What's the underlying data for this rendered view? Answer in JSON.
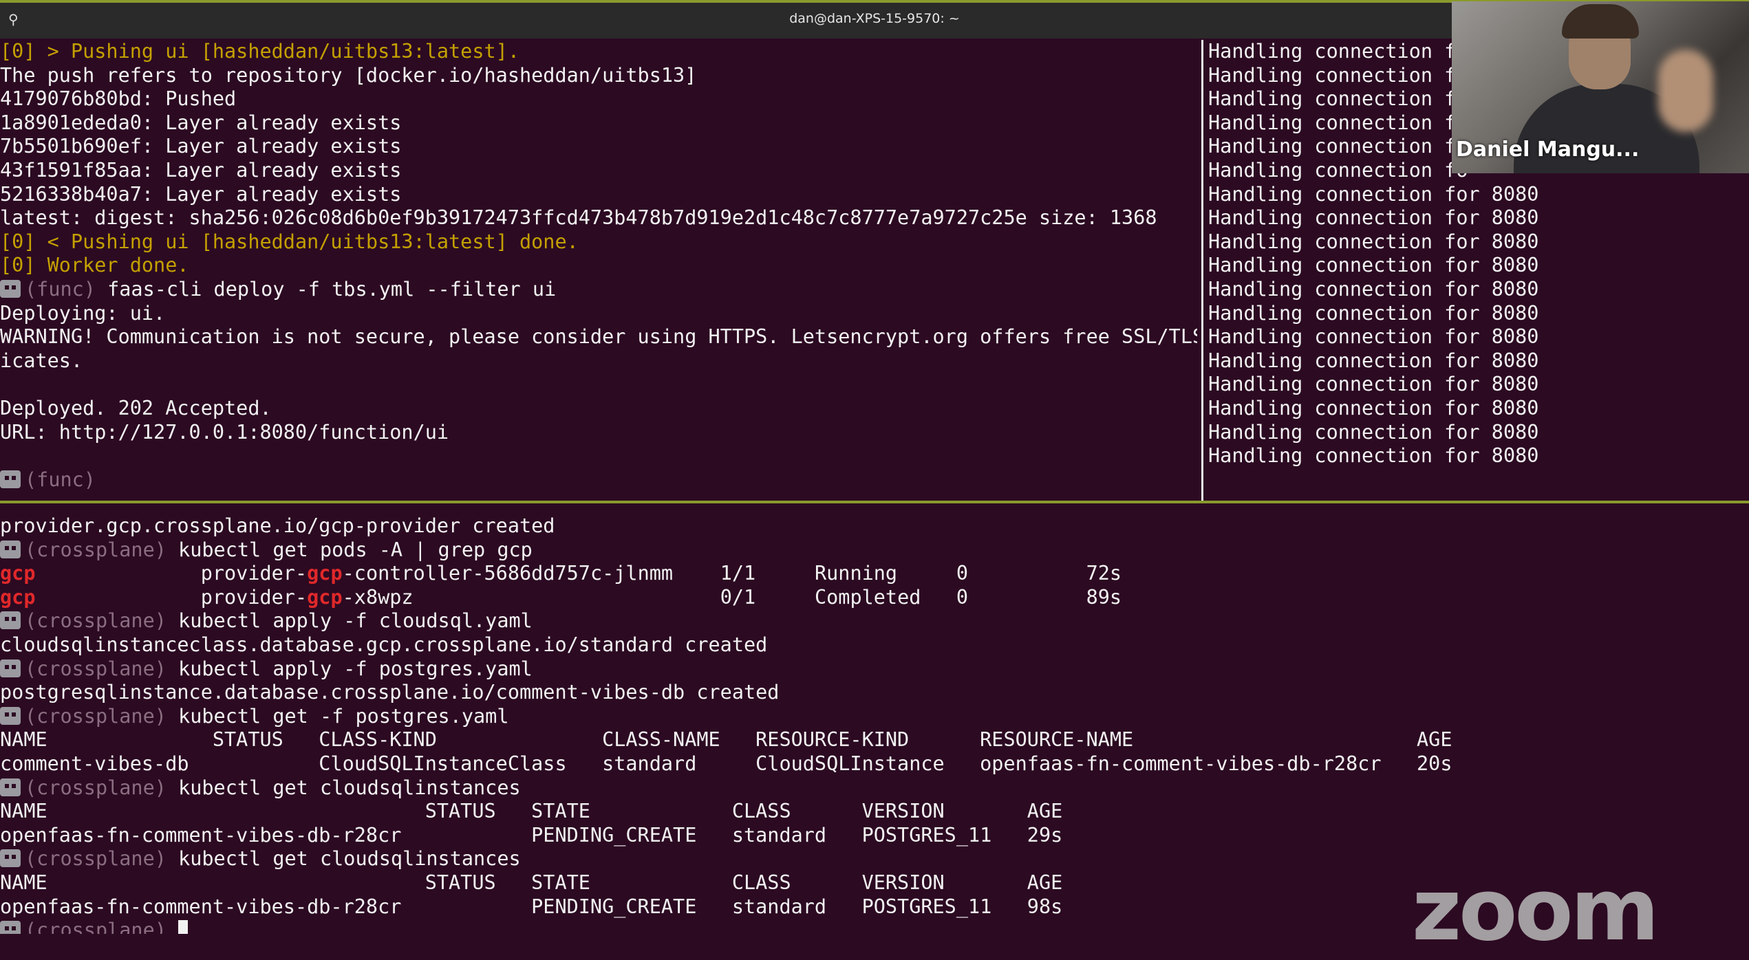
{
  "window": {
    "title": "dan@dan-XPS-15-9570: ~"
  },
  "left_pane": [
    {
      "t": "[0] > Pushing ui [hasheddan/uitbs13:latest].",
      "c": "y"
    },
    {
      "t": "The push refers to repository [docker.io/hasheddan/uitbs13]"
    },
    {
      "t": "4179076b80bd: Pushed"
    },
    {
      "t": "1a8901ededa0: Layer already exists"
    },
    {
      "t": "7b5501b690ef: Layer already exists"
    },
    {
      "t": "43f1591f85aa: Layer already exists"
    },
    {
      "t": "5216338b40a7: Layer already exists"
    },
    {
      "t": "latest: digest: sha256:026c08d6b0ef9b39172473ffcd473b478b7d919e2d1c48c7c8777e7a9727c25e size: 1368"
    },
    {
      "t": "[0] < Pushing ui [hasheddan/uitbs13:latest] done.",
      "c": "y"
    },
    {
      "t": "[0] Worker done.",
      "c": "y"
    },
    {
      "p": "(func)",
      "t": " faas-cli deploy -f tbs.yml --filter ui"
    },
    {
      "t": "Deploying: ui."
    },
    {
      "t": "WARNING! Communication is not secure, please consider using HTTPS. Letsencrypt.org offers free SSL/TLS certif"
    },
    {
      "t": "icates."
    },
    {
      "t": ""
    },
    {
      "t": "Deployed. 202 Accepted."
    },
    {
      "t": "URL: http://127.0.0.1:8080/function/ui"
    },
    {
      "t": ""
    },
    {
      "p": "(func)",
      "t": ""
    }
  ],
  "right_pane": [
    "Handling connection fo",
    "Handling connection fo",
    "Handling connection fo",
    "Handling connection fo",
    "Handling connection fo",
    "Handling connection fo",
    "Handling connection for 8080",
    "Handling connection for 8080",
    "Handling connection for 8080",
    "Handling connection for 8080",
    "Handling connection for 8080",
    "Handling connection for 8080",
    "Handling connection for 8080",
    "Handling connection for 8080",
    "Handling connection for 8080",
    "Handling connection for 8080",
    "Handling connection for 8080",
    "Handling connection for 8080"
  ],
  "bottom_pane": [
    {
      "t": "provider.gcp.crossplane.io/gcp-provider created"
    },
    {
      "p": "(crossplane)",
      "t": " kubectl get pods -A | grep gcp"
    },
    {
      "segs": [
        {
          "t": "gcp",
          "c": "r"
        },
        {
          "t": "              provider-"
        },
        {
          "t": "gcp",
          "c": "r"
        },
        {
          "t": "-controller-5686dd757c-jlnmm    1/1     Running     0          72s"
        }
      ]
    },
    {
      "segs": [
        {
          "t": "gcp",
          "c": "r"
        },
        {
          "t": "              provider-"
        },
        {
          "t": "gcp",
          "c": "r"
        },
        {
          "t": "-x8wpz                          0/1     Completed   0          89s"
        }
      ]
    },
    {
      "p": "(crossplane)",
      "t": " kubectl apply -f cloudsql.yaml"
    },
    {
      "t": "cloudsqlinstanceclass.database.gcp.crossplane.io/standard created"
    },
    {
      "p": "(crossplane)",
      "t": " kubectl apply -f postgres.yaml"
    },
    {
      "t": "postgresqlinstance.database.crossplane.io/comment-vibes-db created"
    },
    {
      "p": "(crossplane)",
      "t": " kubectl get -f postgres.yaml"
    },
    {
      "t": "NAME              STATUS   CLASS-KIND              CLASS-NAME   RESOURCE-KIND      RESOURCE-NAME                        AGE"
    },
    {
      "t": "comment-vibes-db           CloudSQLInstanceClass   standard     CloudSQLInstance   openfaas-fn-comment-vibes-db-r28cr   20s"
    },
    {
      "p": "(crossplane)",
      "t": " kubectl get cloudsqlinstances"
    },
    {
      "t": "NAME                                STATUS   STATE            CLASS      VERSION       AGE"
    },
    {
      "t": "openfaas-fn-comment-vibes-db-r28cr           PENDING_CREATE   standard   POSTGRES_11   29s"
    },
    {
      "p": "(crossplane)",
      "t": " kubectl get cloudsqlinstances"
    },
    {
      "t": "NAME                                STATUS   STATE            CLASS      VERSION       AGE"
    },
    {
      "t": "openfaas-fn-comment-vibes-db-r28cr           PENDING_CREATE   standard   POSTGRES_11   98s"
    },
    {
      "p": "(crossplane)",
      "t": " ",
      "cursor": true
    }
  ],
  "webcam": {
    "name": "Daniel Mangu..."
  },
  "watermark": "zoom"
}
